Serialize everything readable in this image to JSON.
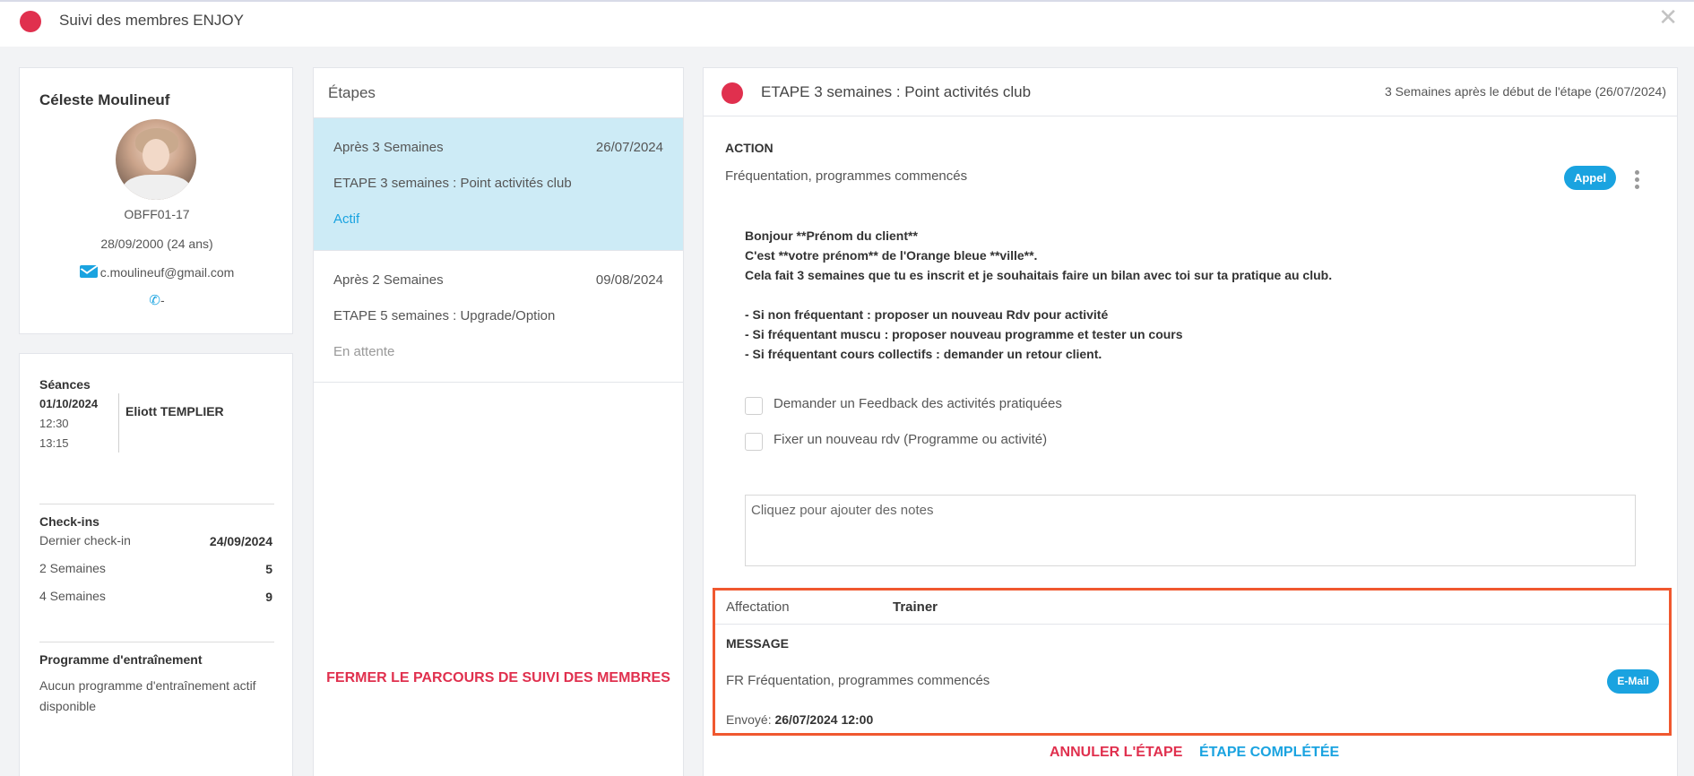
{
  "window": {
    "title": "Suivi des membres ENJOY",
    "close_label": "✕"
  },
  "profile": {
    "name": "Céleste Moulineuf",
    "id": "OBFF01-17",
    "birth": "28/09/2000 (24 ans)",
    "email": "c.moulineuf@gmail.com",
    "phone": "-"
  },
  "stats": {
    "seances_label": "Séances",
    "seance_date": "01/10/2024",
    "seance_start": "12:30",
    "seance_end": "13:15",
    "seance_coach": "Eliott TEMPLIER",
    "checkins_label": "Check-ins",
    "checkins": [
      {
        "label": "Dernier check-in",
        "value": "24/09/2024"
      },
      {
        "label": "2 Semaines",
        "value": "5"
      },
      {
        "label": "4 Semaines",
        "value": "9"
      }
    ],
    "program_label": "Programme d'entraînement",
    "program_line1": "Aucun programme d'entraînement actif",
    "program_line2": "disponible"
  },
  "steps": {
    "title": "Étapes",
    "items": [
      {
        "after": "Après 3 Semaines",
        "date": "26/07/2024",
        "name": "ETAPE 3 semaines : Point activités club",
        "status": "Actif"
      },
      {
        "after": "Après 2 Semaines",
        "date": "09/08/2024",
        "name": "ETAPE 5 semaines : Upgrade/Option",
        "status": "En attente"
      }
    ],
    "close_link": "FERMER LE PARCOURS DE SUIVI DES MEMBRES"
  },
  "detail": {
    "title": "ETAPE 3 semaines : Point activités club",
    "subtitle": "3 Semaines après le début de l'étape (26/07/2024)",
    "action_label": "ACTION",
    "action_text": "Fréquentation, programmes commencés",
    "call_button": "Appel",
    "script_lines": [
      "Bonjour **Prénom du client**",
      "C'est **votre prénom** de l'Orange bleue **ville**.",
      "Cela fait 3 semaines que tu es inscrit et je souhaitais faire un bilan avec toi sur ta pratique au club.",
      "",
      "- Si non fréquentant : proposer un nouveau Rdv pour activité",
      "- Si fréquentant muscu : proposer nouveau programme et tester un cours",
      "- Si fréquentant cours collectifs : demander un retour client."
    ],
    "checkboxes": [
      "Demander un Feedback des activités pratiquées",
      "Fixer un nouveau rdv (Programme ou activité)"
    ],
    "notes_placeholder": "Cliquez pour ajouter des notes",
    "affectation_label": "Affectation",
    "affectation_value": "Trainer",
    "message_label": "MESSAGE",
    "message_text": "FR Fréquentation, programmes commencés",
    "email_button": "E-Mail",
    "sent_label": "Envoyé:",
    "sent_value": "26/07/2024 12:00",
    "cancel_link": "ANNULER L'ÉTAPE",
    "complete_link": "ÉTAPE COMPLÉTÉE"
  },
  "colors": {
    "accent_red": "#e0304e",
    "accent_blue": "#1aa3e0",
    "active_bg": "#cdebf6",
    "highlight": "#f0582f"
  }
}
